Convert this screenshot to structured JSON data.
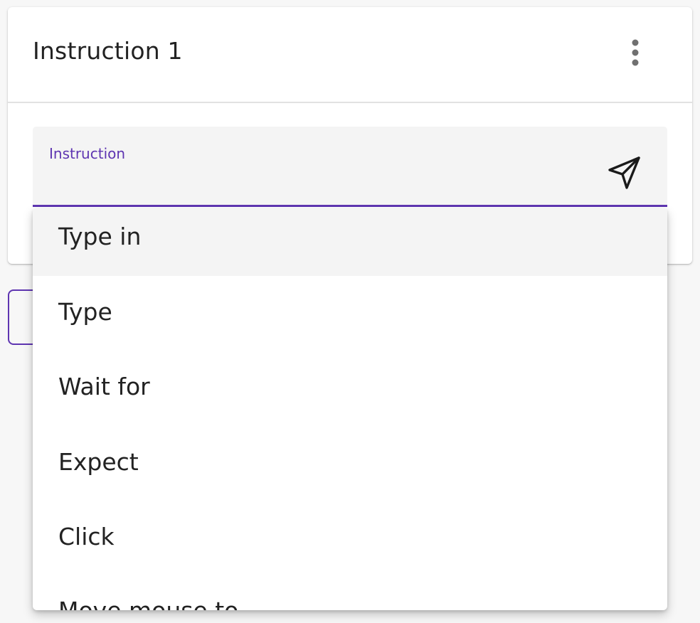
{
  "card": {
    "title": "Instruction 1",
    "menu_icon": "more-vert-icon"
  },
  "field": {
    "label": "Instruction",
    "value": "",
    "placeholder": "",
    "send_icon": "send-icon"
  },
  "dropdown": {
    "options": [
      {
        "label": "Type in",
        "highlighted": true
      },
      {
        "label": "Type",
        "highlighted": false
      },
      {
        "label": "Wait for",
        "highlighted": false
      },
      {
        "label": "Expect",
        "highlighted": false
      },
      {
        "label": "Click",
        "highlighted": false
      },
      {
        "label": "Move mouse to",
        "highlighted": false
      }
    ]
  },
  "colors": {
    "accent": "#5e35b1",
    "field_bg": "#f4f4f4",
    "text": "#222222",
    "page_bg": "#f7f7f7"
  }
}
